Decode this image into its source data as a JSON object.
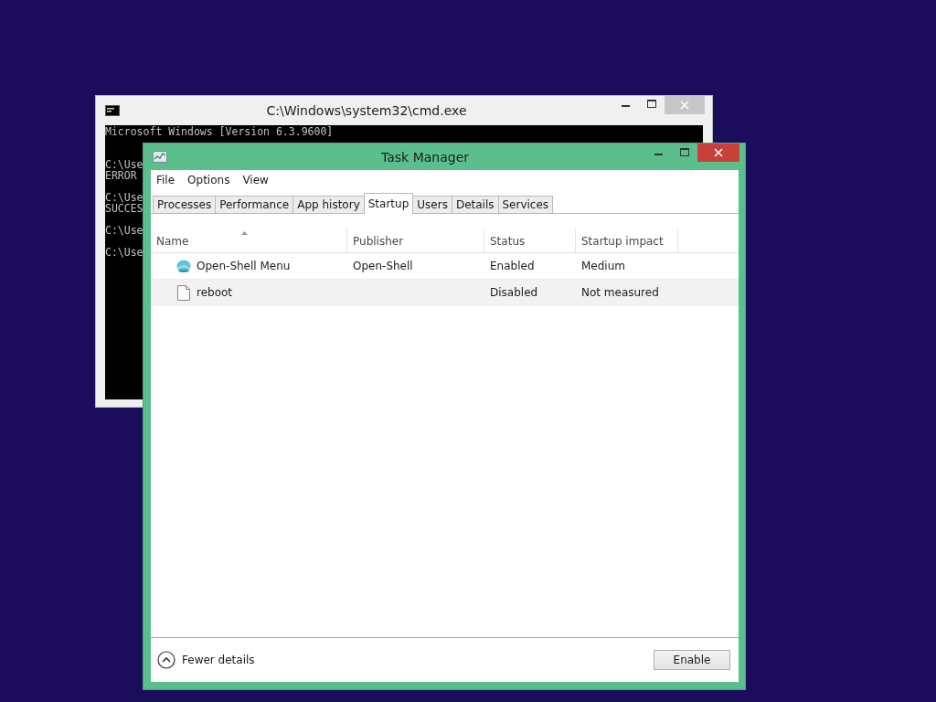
{
  "console_window": {
    "title": "C:\\Windows\\system32\\cmd.exe",
    "blocks": [
      [
        "Microsoft Windows [Version 6.3.9600]"
      ],
      [
        "C:\\Use",
        "ERROR"
      ],
      [
        "C:\\Use",
        "SUCCES"
      ],
      [
        "C:\\Use"
      ],
      [
        "C:\\Use"
      ]
    ]
  },
  "task_manager": {
    "title": "Task Manager",
    "menu": [
      "File",
      "Options",
      "View"
    ],
    "tabs": [
      {
        "label": "Processes",
        "selected": false
      },
      {
        "label": "Performance",
        "selected": false
      },
      {
        "label": "App history",
        "selected": false
      },
      {
        "label": "Startup",
        "selected": true
      },
      {
        "label": "Users",
        "selected": false
      },
      {
        "label": "Details",
        "selected": false
      },
      {
        "label": "Services",
        "selected": false
      }
    ],
    "columns": [
      "Name",
      "Publisher",
      "Status",
      "Startup impact"
    ],
    "rows": [
      {
        "kind": "app",
        "name": "Open-Shell Menu",
        "publisher": "Open-Shell",
        "status": "Enabled",
        "impact": "Medium",
        "selected": false
      },
      {
        "kind": "file",
        "name": "reboot",
        "status": "Disabled",
        "impact": "Not measured",
        "selected": true
      }
    ],
    "fewer_details": "Fewer details",
    "action_button": "Enable"
  }
}
